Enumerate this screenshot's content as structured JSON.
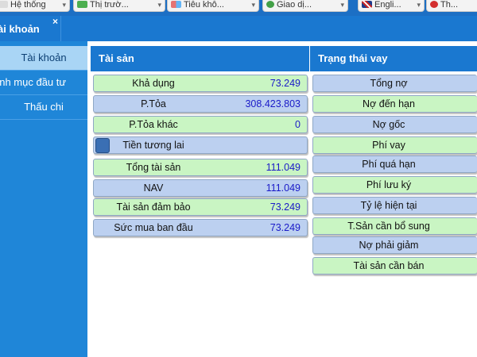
{
  "top_tabs": [
    {
      "label": "Hệ thống",
      "icon": "system-icon",
      "icon_color": "#e0e0e0"
    },
    {
      "label": "Thị trườ...",
      "icon": "market-icon",
      "icon_color": "#4caf50"
    },
    {
      "label": "Tiêu khô...",
      "icon": "tools-icon",
      "icon_color": "#e57373"
    },
    {
      "label": "Giao dị...",
      "icon": "trade-icon",
      "icon_color": "#43a047"
    },
    {
      "label": "Engli...",
      "icon": "uk-flag-icon",
      "icon_color": "#c62828"
    },
    {
      "label": "Th...",
      "icon": "logout-icon",
      "icon_color": "#d32f2f"
    }
  ],
  "window_tab": {
    "label": "ài khoản",
    "close": "×"
  },
  "nav": [
    {
      "label": "Tài khoản",
      "active": true
    },
    {
      "label": "anh mục đầu tư",
      "active": false
    },
    {
      "label": "Thấu chi",
      "active": false
    }
  ],
  "assets": {
    "title": "Tài sản",
    "rows": [
      {
        "label": "Khả dụng",
        "value": "73.249",
        "color": "green"
      },
      {
        "label": "P.Tỏa",
        "value": "308.423.803",
        "color": "blue"
      },
      {
        "label": "P.Tỏa khác",
        "value": "0",
        "color": "green"
      },
      {
        "label": "Tiền tương lai",
        "value": "",
        "color": "blue"
      },
      {
        "label": "Tổng tài sản",
        "value": "111.049",
        "color": "green"
      },
      {
        "label": "NAV",
        "value": "111.049",
        "color": "blue"
      },
      {
        "label": "Tài sản đảm bảo",
        "value": "73.249",
        "color": "green"
      },
      {
        "label": "Sức mua ban đầu",
        "value": "73.249",
        "color": "blue"
      }
    ]
  },
  "loan": {
    "title": "Trạng thái vay",
    "rows": [
      {
        "label": "Tổng nợ",
        "color": "blue"
      },
      {
        "label": "Nợ đến hạn",
        "color": "green"
      },
      {
        "label": "Nợ gốc",
        "color": "blue"
      },
      {
        "label": "Phí vay",
        "color": "green"
      },
      {
        "label": "Phí quá hạn",
        "color": "blue"
      },
      {
        "label": "Phí lưu ký",
        "color": "green"
      },
      {
        "label": "Tỷ lệ hiện tại",
        "color": "blue"
      },
      {
        "label": "T.Sản cần bổ sung",
        "color": "green"
      },
      {
        "label": "Nợ phải giảm",
        "color": "blue"
      },
      {
        "label": "Tài sản cần bán",
        "color": "green"
      }
    ]
  }
}
